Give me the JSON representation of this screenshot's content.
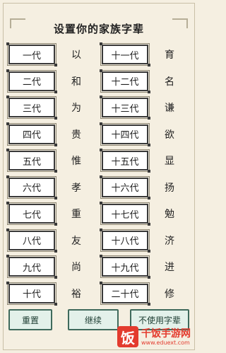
{
  "title": "设置你的家族字辈",
  "generations": [
    {
      "left": {
        "label": "一代",
        "char": "以"
      },
      "right": {
        "label": "十一代",
        "char": "育"
      }
    },
    {
      "left": {
        "label": "二代",
        "char": "和"
      },
      "right": {
        "label": "十二代",
        "char": "名"
      }
    },
    {
      "left": {
        "label": "三代",
        "char": "为"
      },
      "right": {
        "label": "十三代",
        "char": "谦"
      }
    },
    {
      "left": {
        "label": "四代",
        "char": "贵"
      },
      "right": {
        "label": "十四代",
        "char": "欲"
      }
    },
    {
      "left": {
        "label": "五代",
        "char": "惟"
      },
      "right": {
        "label": "十五代",
        "char": "显"
      }
    },
    {
      "left": {
        "label": "六代",
        "char": "孝"
      },
      "right": {
        "label": "十六代",
        "char": "扬"
      }
    },
    {
      "left": {
        "label": "七代",
        "char": "重"
      },
      "right": {
        "label": "十七代",
        "char": "勉"
      }
    },
    {
      "left": {
        "label": "八代",
        "char": "友"
      },
      "right": {
        "label": "十八代",
        "char": "济"
      }
    },
    {
      "left": {
        "label": "九代",
        "char": "尚"
      },
      "right": {
        "label": "十九代",
        "char": "进"
      }
    },
    {
      "left": {
        "label": "十代",
        "char": "裕"
      },
      "right": {
        "label": "二十代",
        "char": "修"
      }
    }
  ],
  "buttons": {
    "reset": "重置",
    "continue": "继续",
    "no_use": "不使用字辈"
  },
  "watermark": {
    "logo_char": "饭",
    "title": "千饭手游网",
    "url": "www.eduext.com"
  }
}
